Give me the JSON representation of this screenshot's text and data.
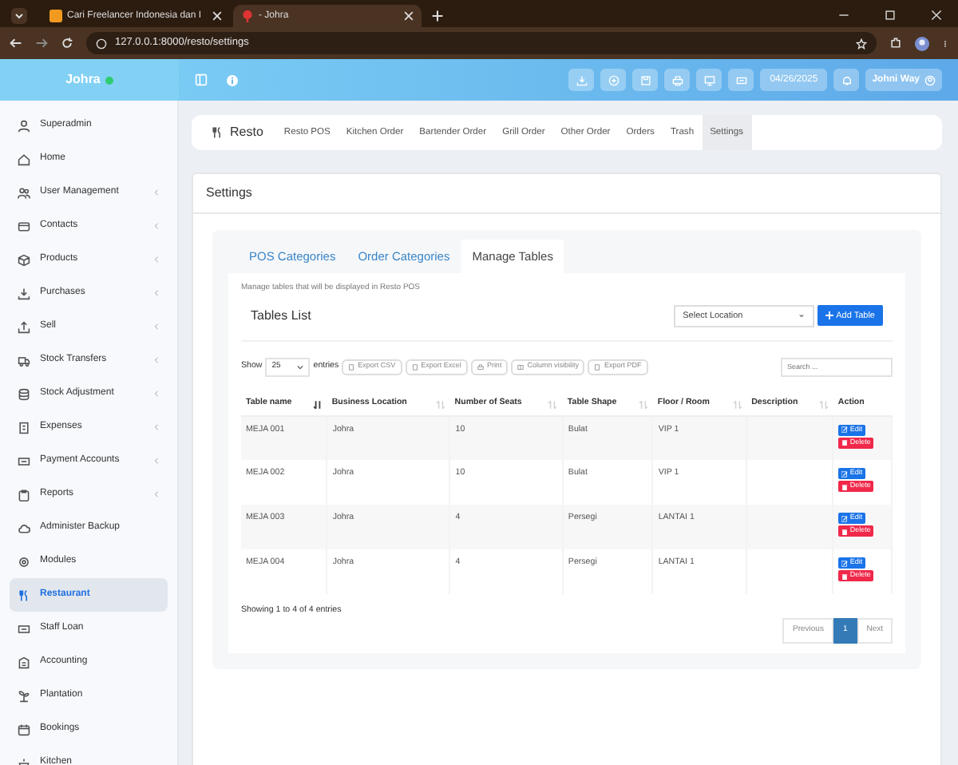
{
  "browser": {
    "tabs": [
      {
        "title": "Cari Freelancer Indonesia dan I",
        "selected": false
      },
      {
        "title": "- Johra",
        "selected": true
      }
    ],
    "url": "127.0.0.1:8000/resto/settings"
  },
  "app_header": {
    "brand": "Johra",
    "date": "04/26/2025",
    "user": "Johni Way"
  },
  "sidebar": {
    "items": [
      {
        "label": "Superadmin",
        "has_submenu": false,
        "selected": false
      },
      {
        "label": "Home",
        "has_submenu": false,
        "selected": false
      },
      {
        "label": "User Management",
        "has_submenu": true,
        "selected": false
      },
      {
        "label": "Contacts",
        "has_submenu": true,
        "selected": false
      },
      {
        "label": "Products",
        "has_submenu": true,
        "selected": false
      },
      {
        "label": "Purchases",
        "has_submenu": true,
        "selected": false
      },
      {
        "label": "Sell",
        "has_submenu": true,
        "selected": false
      },
      {
        "label": "Stock Transfers",
        "has_submenu": true,
        "selected": false
      },
      {
        "label": "Stock Adjustment",
        "has_submenu": true,
        "selected": false
      },
      {
        "label": "Expenses",
        "has_submenu": true,
        "selected": false
      },
      {
        "label": "Payment Accounts",
        "has_submenu": true,
        "selected": false
      },
      {
        "label": "Reports",
        "has_submenu": true,
        "selected": false
      },
      {
        "label": "Administer Backup",
        "has_submenu": false,
        "selected": false
      },
      {
        "label": "Modules",
        "has_submenu": false,
        "selected": false
      },
      {
        "label": "Restaurant",
        "has_submenu": false,
        "selected": true
      },
      {
        "label": "Staff Loan",
        "has_submenu": false,
        "selected": false
      },
      {
        "label": "Accounting",
        "has_submenu": false,
        "selected": false
      },
      {
        "label": "Plantation",
        "has_submenu": false,
        "selected": false
      },
      {
        "label": "Bookings",
        "has_submenu": false,
        "selected": false
      },
      {
        "label": "Kitchen",
        "has_submenu": false,
        "selected": false
      }
    ]
  },
  "resto_nav": {
    "title": "Resto",
    "items": [
      {
        "label": "Resto POS",
        "selected": false
      },
      {
        "label": "Kitchen Order",
        "selected": false
      },
      {
        "label": "Bartender Order",
        "selected": false
      },
      {
        "label": "Grill Order",
        "selected": false
      },
      {
        "label": "Other Order",
        "selected": false
      },
      {
        "label": "Orders",
        "selected": false
      },
      {
        "label": "Trash",
        "selected": false
      },
      {
        "label": "Settings",
        "selected": true
      }
    ]
  },
  "page_title": "Settings",
  "settings_tabs": [
    {
      "label": "POS Categories",
      "selected": false
    },
    {
      "label": "Order Categories",
      "selected": false
    },
    {
      "label": "Manage Tables",
      "selected": true
    }
  ],
  "description": "Manage tables that will be displayed in Resto POS",
  "tables_list": {
    "title": "Tables List",
    "location_select": {
      "placeholder": "Select Location"
    },
    "add_button": "Add Table"
  },
  "datatable": {
    "show_label": "Show",
    "page_size": "25",
    "entries_label": "entries",
    "export_buttons": [
      "Export CSV",
      "Export Excel",
      "Print",
      "Column visibility",
      "Export PDF"
    ],
    "search": {
      "placeholder": "Search ..."
    },
    "columns": [
      {
        "label": "Table name",
        "sortable": true,
        "sorted": true
      },
      {
        "label": "Business Location",
        "sortable": true,
        "sorted": false
      },
      {
        "label": "Number of Seats",
        "sortable": true,
        "sorted": false
      },
      {
        "label": "Table Shape",
        "sortable": true,
        "sorted": false
      },
      {
        "label": "Floor / Room",
        "sortable": true,
        "sorted": false
      },
      {
        "label": "Description",
        "sortable": true,
        "sorted": false
      },
      {
        "label": "Action",
        "sortable": false
      }
    ],
    "rows": [
      {
        "cells": [
          "MEJA 001",
          "Johra",
          "10",
          "Bulat",
          "VIP 1",
          ""
        ],
        "actions": [
          "Edit",
          "Delete"
        ]
      },
      {
        "cells": [
          "MEJA 002",
          "Johra",
          "10",
          "Bulat",
          "VIP 1",
          ""
        ],
        "actions": [
          "Edit",
          "Delete"
        ]
      },
      {
        "cells": [
          "MEJA 003",
          "Johra",
          "4",
          "Persegi",
          "LANTAI 1",
          ""
        ],
        "actions": [
          "Edit",
          "Delete"
        ]
      },
      {
        "cells": [
          "MEJA 004",
          "Johra",
          "4",
          "Persegi",
          "LANTAI 1",
          ""
        ],
        "actions": [
          "Edit",
          "Delete"
        ]
      }
    ],
    "info": "Showing 1 to 4 of 4 entries",
    "pagination": [
      {
        "label": "Previous",
        "selected": false
      },
      {
        "label": "1",
        "selected": true
      },
      {
        "label": "Next",
        "selected": false
      }
    ]
  }
}
